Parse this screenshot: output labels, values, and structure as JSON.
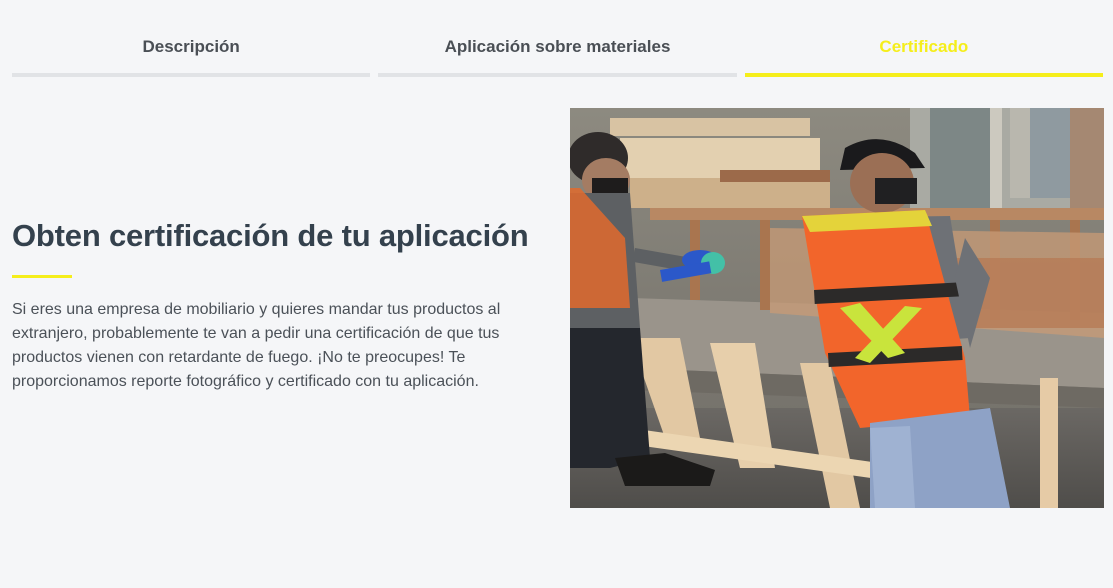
{
  "tabs": [
    {
      "label": "Descripción",
      "active": false
    },
    {
      "label": "Aplicación sobre materiales",
      "active": false
    },
    {
      "label": "Certificado",
      "active": true
    }
  ],
  "colors": {
    "accent": "#f5ee1b",
    "heading": "#34414d",
    "body_text": "#4b5158",
    "background": "#f5f6f8",
    "tab_inactive": "#e1e3e6"
  },
  "section": {
    "heading": "Obten certificación de tu aplicación",
    "body": "Si eres una empresa de mobiliario y quieres mandar tus productos al extranjero, probablemente te van a pedir una certificación de que tus productos vienen con retardante de fuego. ¡No te preocupes! Te proporcionamos reporte fotográfico y certificado con tu aplicación."
  },
  "photo": {
    "subject": "workers-in-safety-vests-applying-fire-retardant-to-wooden-furniture"
  }
}
